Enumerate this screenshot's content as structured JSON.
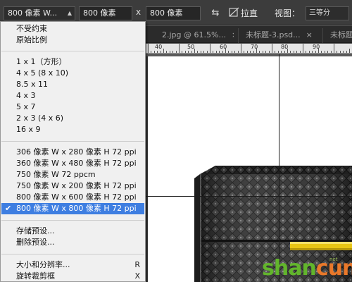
{
  "options_bar": {
    "ratio_select": "800 像素 W...",
    "width_value": "800 像素",
    "swap_symbol": "x",
    "height_value": "800 像素",
    "clear_symbol": "⇆",
    "straighten_label": "拉直",
    "view_label": "视图：",
    "view_select": "三等分"
  },
  "tabs": [
    {
      "label": "2.jpg @ 61.5%...",
      "close": "×"
    },
    {
      "label": "未标题-3.psd...",
      "close": "×"
    },
    {
      "label": "未标题",
      "close": ""
    }
  ],
  "ruler": {
    "labels": [
      "40",
      "50",
      "60",
      "70",
      "80",
      "90"
    ]
  },
  "dropdown": {
    "group_1": [
      "不受约束",
      "原始比例"
    ],
    "group_2": [
      "1 x 1（方形）",
      "4 x 5 (8 x 10)",
      "8.5 x 11",
      "4 x 3",
      "5 x 7",
      "2 x 3 (4 x 6)",
      "16 x 9"
    ],
    "group_3": [
      "306 像素 W x 280 像素 H 72 ppi",
      "360 像素 W x 480 像素 H 72 ppi",
      "750 像素 W 72 ppcm",
      "750 像素 W x 200 像素 H 72 ppi",
      "800 像素 W x 600 像素 H 72 ppi",
      "800 像素 W x 800 像素 H 72 ppi"
    ],
    "selected_check": "✔",
    "group_4": [
      "存储预设...",
      "删除预设..."
    ],
    "group_5": [
      {
        "label": "大小和分辨率...",
        "shortcut": "R"
      },
      {
        "label": "旋转裁剪框",
        "shortcut": "X"
      }
    ]
  },
  "watermark": {
    "part_a": "shan",
    "part_b": "cun",
    "suffix": "net"
  },
  "colors": {
    "selection": "#3e7ee1",
    "watermark_green": "#62b52c",
    "watermark_orange": "#e9782a",
    "strap_yellow": "#e7c514"
  }
}
